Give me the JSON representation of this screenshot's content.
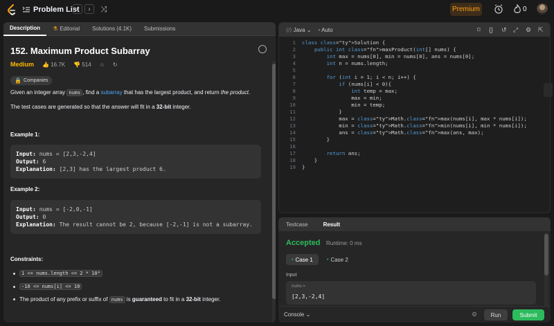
{
  "topbar": {
    "problem_list": "Problem List",
    "prev": "‹",
    "next": "›",
    "shuffle": "⤨",
    "premium": "Premium",
    "streak": "0"
  },
  "left_tabs": [
    {
      "label": "Description"
    },
    {
      "label": "Editorial"
    },
    {
      "label": "Solutions (4.1K)"
    },
    {
      "label": "Submissions"
    }
  ],
  "problem": {
    "title": "152. Maximum Product Subarray",
    "difficulty": "Medium",
    "likes": "16.7K",
    "dislikes": "514",
    "companies": "Companies",
    "intro_a": "Given an integer array ",
    "intro_code": "nums",
    "intro_b": ", find a ",
    "intro_link": "subarray",
    "intro_c": " that has the largest product, and return ",
    "intro_em": "the product",
    "intro_d": ".",
    "note_a": "The test cases are generated so that the answer will fit in a ",
    "note_b": "32-bit",
    "note_c": " integer."
  },
  "examples": [
    {
      "heading": "Example 1:",
      "input_label": "Input:",
      "input": "nums = [2,3,-2,4]",
      "output_label": "Output:",
      "output": "6",
      "explanation_label": "Explanation:",
      "explanation": "[2,3] has the largest product 6."
    },
    {
      "heading": "Example 2:",
      "input_label": "Input:",
      "input": "nums = [-2,0,-1]",
      "output_label": "Output:",
      "output": "0",
      "explanation_label": "Explanation:",
      "explanation": "The result cannot be 2, because [-2,-1] is not a subarray."
    }
  ],
  "constraints": {
    "heading": "Constraints:",
    "c1": "1 <= nums.length <= 2 * 10⁴",
    "c2": "-10 <= nums[i] <= 10",
    "c3_a": "The product of any prefix or suffix of ",
    "c3_code": "nums",
    "c3_b": " is ",
    "c3_bold": "guaranteed",
    "c3_c": " to fit in a ",
    "c3_bold2": "32-bit",
    "c3_d": " integer."
  },
  "editor": {
    "language": "Java",
    "mode": "Auto",
    "lines": [
      {
        "n": "1",
        "code": "class Solution {"
      },
      {
        "n": "2",
        "code": "    public int maxProduct(int[] nums) {"
      },
      {
        "n": "3",
        "code": "        int max = nums[0], min = nums[0], ans = nums[0];"
      },
      {
        "n": "4",
        "code": "        int n = nums.length;"
      },
      {
        "n": "5",
        "code": ""
      },
      {
        "n": "6",
        "code": "        for (int i = 1; i < n; i++) {"
      },
      {
        "n": "7",
        "code": "            if (nums[i] < 0){"
      },
      {
        "n": "8",
        "code": "                int temp = max;"
      },
      {
        "n": "9",
        "code": "                max = min;"
      },
      {
        "n": "10",
        "code": "                min = temp;"
      },
      {
        "n": "11",
        "code": "            }"
      },
      {
        "n": "12",
        "code": "            max = Math.max(nums[i], max * nums[i]);"
      },
      {
        "n": "13",
        "code": "            min = Math.min(nums[i], min * nums[i]);"
      },
      {
        "n": "14",
        "code": "            ans = Math.max(ans, max);"
      },
      {
        "n": "15",
        "code": "        }"
      },
      {
        "n": "16",
        "code": ""
      },
      {
        "n": "17",
        "code": "        return ans;"
      },
      {
        "n": "18",
        "code": "    }"
      },
      {
        "n": "19",
        "code": "}"
      }
    ]
  },
  "test_panel": {
    "tab_testcase": "Testcase",
    "tab_result": "Result",
    "status": "Accepted",
    "runtime": "Runtime: 0 ms",
    "case1": "Case 1",
    "case2": "Case 2",
    "input_label": "Input",
    "var_name": "nums =",
    "var_value": "[2,3,-2,4]",
    "console": "Console",
    "run": "Run",
    "submit": "Submit"
  },
  "colors": {
    "accent_orange": "#ffa116",
    "medium": "#ffb800",
    "accepted_green": "#2cbb5d",
    "link_blue": "#4fa3f7",
    "submit_green": "#2cbb5d"
  }
}
